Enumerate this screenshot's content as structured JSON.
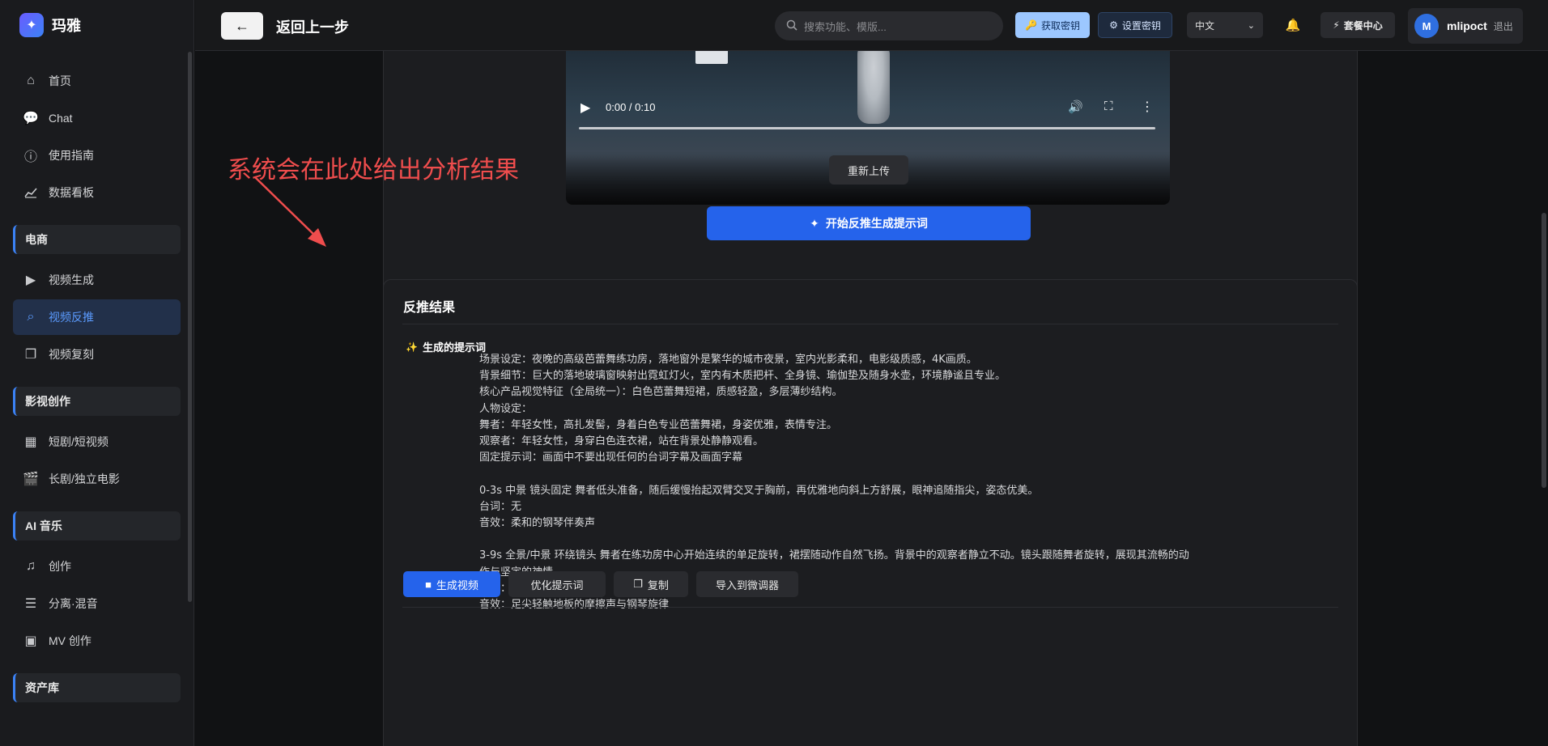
{
  "brand": {
    "name": "玛雅"
  },
  "sidebar": {
    "items_top": [
      {
        "label": "首页",
        "icon": "home-icon"
      },
      {
        "label": "Chat",
        "icon": "chat-icon"
      },
      {
        "label": "使用指南",
        "icon": "help-icon"
      },
      {
        "label": "数据看板",
        "icon": "chart-icon"
      }
    ],
    "section_ecommerce": "电商",
    "items_ecommerce": [
      {
        "label": "视频生成",
        "icon": "video-icon"
      },
      {
        "label": "视频反推",
        "icon": "search-video-icon",
        "active": true
      },
      {
        "label": "视频复刻",
        "icon": "copy-icon"
      }
    ],
    "section_film": "影视创作",
    "items_film": [
      {
        "label": "短剧/短视频",
        "icon": "film-icon"
      },
      {
        "label": "长剧/独立电影",
        "icon": "clapper-icon"
      }
    ],
    "section_music": "AI 音乐",
    "items_music": [
      {
        "label": "创作",
        "icon": "music-note-icon"
      },
      {
        "label": "分离·混音",
        "icon": "mixer-icon"
      },
      {
        "label": "MV 创作",
        "icon": "mv-icon"
      }
    ],
    "section_assets": "资产库"
  },
  "topbar": {
    "back_label": "返回上一步",
    "search_placeholder": "搜索功能、模版...",
    "get_key": "获取密钥",
    "set_key": "设置密钥",
    "language": "中文",
    "package_center": "套餐中心",
    "user_initial": "M",
    "username": "mlipoct",
    "logout": "退出"
  },
  "video": {
    "time": "0:00 / 0:10",
    "progress": 0
  },
  "upload": {
    "reupload": "重新上传",
    "generate": "开始反推生成提示词"
  },
  "annotation": "系统会在此处给出分析结果",
  "result": {
    "title": "反推结果",
    "subhead": "生成的提示词",
    "lines": [
      "场景设定：夜晚的高级芭蕾舞练功房，落地窗外是繁华的城市夜景，室内光影柔和，电影级质感，4K画质。",
      "背景细节：巨大的落地玻璃窗映射出霓虹灯火，室内有木质把杆、全身镜、瑜伽垫及随身水壶，环境静谧且专业。",
      "核心产品视觉特征（全局统一）：白色芭蕾舞短裙，质感轻盈，多层薄纱结构。",
      "人物设定：",
      "舞者：年轻女性，高扎发髻，身着白色专业芭蕾舞裙，身姿优雅，表情专注。",
      "观察者：年轻女性，身穿白色连衣裙，站在背景处静静观看。",
      "固定提示词：画面中不要出现任何的台词字幕及画面字幕",
      "",
      "0-3s 中景 镜头固定 舞者低头准备，随后缓慢抬起双臂交叉于胸前，再优雅地向斜上方舒展，眼神追随指尖，姿态优美。",
      "台词：无",
      "音效：柔和的钢琴伴奏声",
      "",
      "3-9s 全景/中景 环绕镜头 舞者在练功房中心开始连续的单足旋转，裙摆随动作自然飞扬。背景中的观察者静立不动。镜头跟随舞者旋转，展现其流畅的动",
      "作与坚定的神情。",
      "台词：无",
      "音效：足尖轻触地板的摩擦声与钢琴旋律"
    ],
    "actions": {
      "generate_video": "生成视频",
      "optimize": "优化提示词",
      "copy": "复制",
      "import": "导入到微调器"
    }
  }
}
